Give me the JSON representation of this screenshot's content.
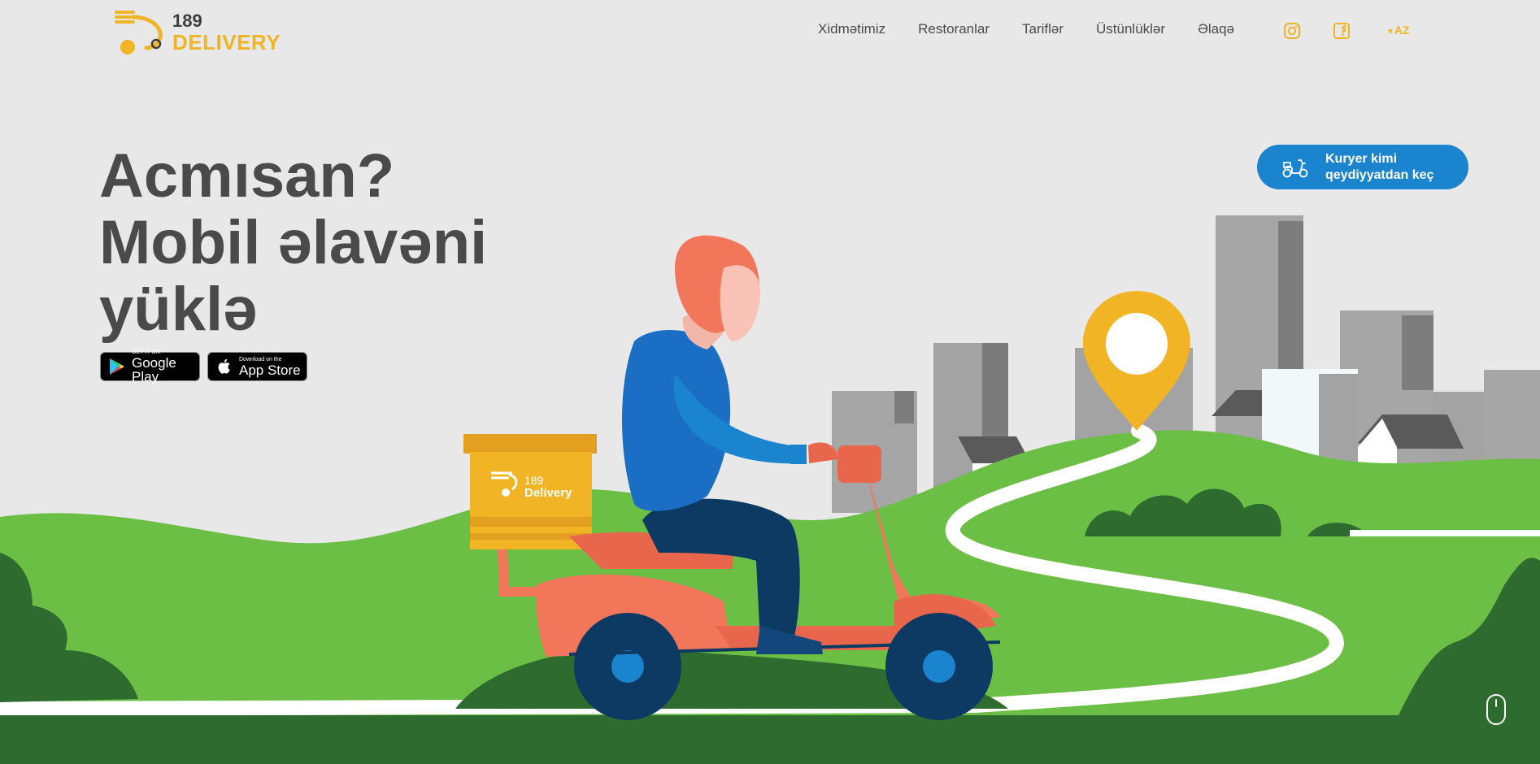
{
  "brand": {
    "number": "189",
    "word": "DELIVERY",
    "box_number": "189",
    "box_word": "Delivery"
  },
  "nav": [
    {
      "label": "Xidmətimiz"
    },
    {
      "label": "Restoranlar"
    },
    {
      "label": "Tariflər"
    },
    {
      "label": "Üstünlüklər"
    },
    {
      "label": "Əlaqə"
    }
  ],
  "social": {
    "instagram": "instagram-icon",
    "facebook": "facebook-icon"
  },
  "language": {
    "current": "AZ",
    "arrow": "▼"
  },
  "hero": {
    "line1": "Acmısan?",
    "line2": "Mobil əlavəni",
    "line3": "yüklə"
  },
  "stores": {
    "google": {
      "small": "GET IT ON",
      "big": "Google Play"
    },
    "apple": {
      "small": "Download on the",
      "big": "App Store"
    }
  },
  "courier_button": {
    "line1": "Kuryer kimi",
    "line2": "qeydiyyatdan keç"
  },
  "colors": {
    "accent": "#f0b425",
    "button_blue": "#1a84cf",
    "grass": "#6cbf45",
    "dark_grass": "#2e6b2e",
    "scooter": "#f2775a",
    "jacket": "#1a6fc4",
    "background": "#e8e8e8"
  }
}
